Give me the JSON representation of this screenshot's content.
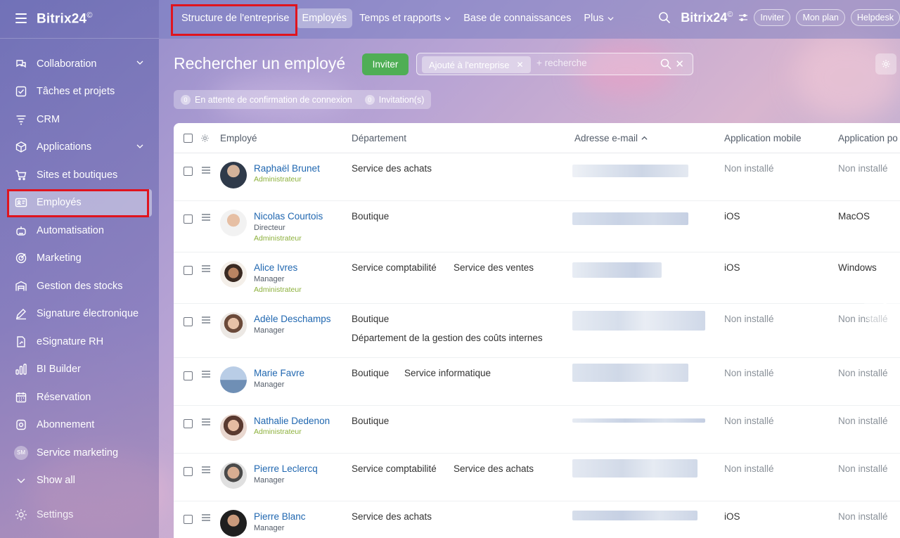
{
  "app": {
    "brand": "Bitrix24",
    "brand_mark": "©"
  },
  "sidebar": {
    "items": [
      {
        "label": "Collaboration",
        "icon": "chat-bubbles-icon",
        "expandable": true
      },
      {
        "label": "Tâches et projets",
        "icon": "checkbox-icon",
        "expandable": false
      },
      {
        "label": "CRM",
        "icon": "filter-funnel-icon",
        "expandable": false
      },
      {
        "label": "Applications",
        "icon": "cube-icon",
        "expandable": true
      },
      {
        "label": "Sites et boutiques",
        "icon": "cart-icon",
        "expandable": false
      },
      {
        "label": "Employés",
        "icon": "id-card-icon",
        "expandable": false,
        "active": true
      },
      {
        "label": "Automatisation",
        "icon": "robot-icon",
        "expandable": false
      },
      {
        "label": "Marketing",
        "icon": "target-icon",
        "expandable": false
      },
      {
        "label": "Gestion des stocks",
        "icon": "warehouse-icon",
        "expandable": false
      },
      {
        "label": "Signature électronique",
        "icon": "pen-icon",
        "expandable": false
      },
      {
        "label": "eSignature RH",
        "icon": "document-sign-icon",
        "expandable": false
      },
      {
        "label": "BI Builder",
        "icon": "bar-chart-icon",
        "expandable": false
      },
      {
        "label": "Réservation",
        "icon": "calendar-icon",
        "expandable": false
      },
      {
        "label": "Abonnement",
        "icon": "subscription-icon",
        "expandable": false
      },
      {
        "label": "Service marketing",
        "icon": "sm-badge",
        "badge": "SM",
        "expandable": false
      },
      {
        "label": "Show all",
        "icon": "chevron-down-icon",
        "expandable": false
      }
    ],
    "settings_label": "Settings"
  },
  "topnav": {
    "items": [
      {
        "label": "Structure de l'entreprise",
        "active": false,
        "dropdown": false
      },
      {
        "label": "Employés",
        "active": true,
        "dropdown": false
      },
      {
        "label": "Temps et rapports",
        "active": false,
        "dropdown": true
      },
      {
        "label": "Base de connaissances",
        "active": false,
        "dropdown": false
      },
      {
        "label": "Plus",
        "active": false,
        "dropdown": true
      }
    ],
    "brand": "Bitrix24",
    "brand_mark": "©",
    "pills": [
      "Inviter",
      "Mon plan",
      "Helpdesk"
    ]
  },
  "page": {
    "title": "Rechercher un employé",
    "invite_label": "Inviter",
    "filter_tag": "Ajouté à l'entreprise",
    "search_placeholder": "+ recherche",
    "counters": [
      {
        "count": "0",
        "label": "En attente de confirmation de connexion"
      },
      {
        "count": "0",
        "label": "Invitation(s)"
      }
    ]
  },
  "table": {
    "columns": [
      "Employé",
      "Département",
      "Adresse e-mail",
      "Application mobile",
      "Application po"
    ],
    "sort_indicator": "^",
    "rows": [
      {
        "name": "Raphaël Brunet",
        "position": "",
        "role": "Administrateur",
        "departments": [
          "Service des achats"
        ],
        "mobile": "Non installé",
        "desktop": "Non installé"
      },
      {
        "name": "Nicolas Courtois",
        "position": "Directeur",
        "role": "Administrateur",
        "departments": [
          "Boutique"
        ],
        "mobile": "iOS",
        "desktop": "MacOS"
      },
      {
        "name": "Alice Ivres",
        "position": "Manager",
        "role": "Administrateur",
        "departments": [
          "Service comptabilité",
          "Service des ventes"
        ],
        "mobile": "iOS",
        "desktop": "Windows"
      },
      {
        "name": "Adèle Deschamps",
        "position": "Manager",
        "role": "",
        "departments": [
          "Boutique",
          "Département de la gestion des coûts internes"
        ],
        "mobile": "Non installé",
        "desktop": "Non installé"
      },
      {
        "name": "Marie Favre",
        "position": "Manager",
        "role": "",
        "departments": [
          "Boutique",
          "Service informatique"
        ],
        "mobile": "Non installé",
        "desktop": "Non installé"
      },
      {
        "name": "Nathalie Dedenon",
        "position": "",
        "role": "Administrateur",
        "departments": [
          "Boutique"
        ],
        "mobile": "Non installé",
        "desktop": "Non installé"
      },
      {
        "name": "Pierre Leclercq",
        "position": "Manager",
        "role": "",
        "departments": [
          "Service comptabilité",
          "Service des achats"
        ],
        "mobile": "Non installé",
        "desktop": "Non installé"
      },
      {
        "name": "Pierre Blanc",
        "position": "Manager",
        "role": "",
        "departments": [
          "Service des achats"
        ],
        "mobile": "iOS",
        "desktop": "Non installé"
      }
    ]
  },
  "colors": {
    "accent_green": "#4fae55",
    "link_blue": "#2067b0",
    "admin_green": "#8cb03b",
    "highlight_red": "#e0141e"
  }
}
